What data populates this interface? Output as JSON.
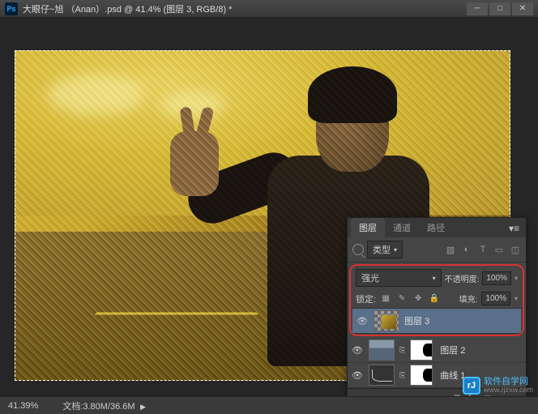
{
  "titlebar": {
    "title": "大眼仔~旭 （Anan）.psd @ 41.4% (图层 3, RGB/8) *"
  },
  "statusbar": {
    "zoom": "41.39%",
    "doc_info": "文档:3.80M/36.6M"
  },
  "panel": {
    "tabs": [
      "图层",
      "通道",
      "路径"
    ],
    "type_label": "类型",
    "blend_mode": "强光",
    "opacity_label": "不透明度:",
    "opacity_value": "100%",
    "lock_label": "锁定:",
    "fill_label": "填充:",
    "fill_value": "100%"
  },
  "layers": [
    {
      "name": "图层 3",
      "selected": true,
      "thumb": "checker",
      "highlighted": true
    },
    {
      "name": "图层 2",
      "selected": false,
      "thumb": "photo",
      "mask": true
    },
    {
      "name": "曲线 1",
      "selected": false,
      "thumb": "curves",
      "mask": true
    }
  ],
  "watermark": {
    "badge": "rJ",
    "text": "软件自学网",
    "sub": "www.rjzxw.com"
  }
}
